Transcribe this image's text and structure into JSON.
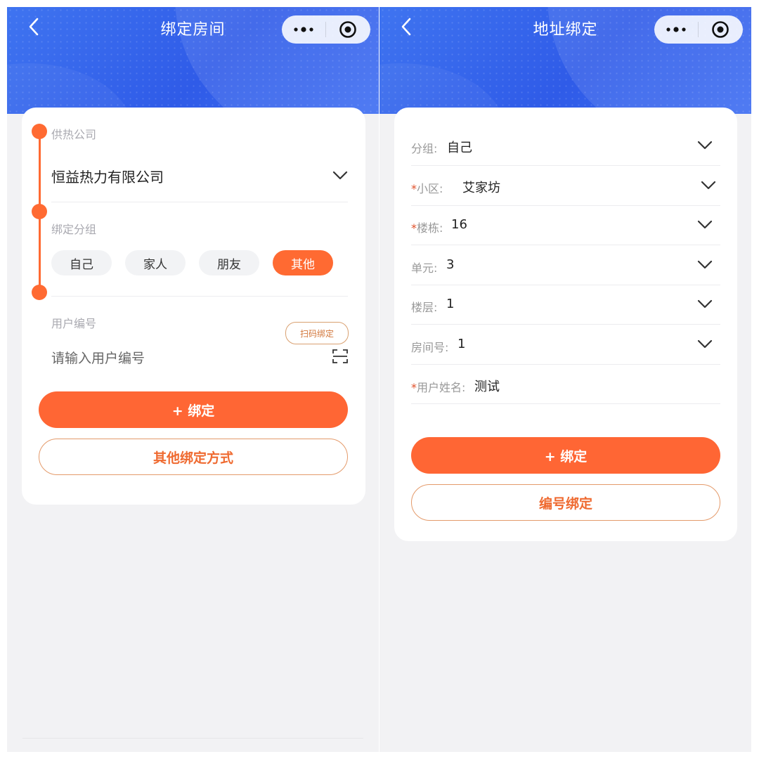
{
  "left": {
    "title": "绑定房间",
    "company": {
      "label": "供热公司",
      "value": "恒益热力有限公司"
    },
    "group": {
      "label": "绑定分组",
      "options": [
        "自己",
        "家人",
        "朋友",
        "其他"
      ],
      "selected": "其他"
    },
    "user_number": {
      "label": "用户编号",
      "placeholder": "请输入用户编号",
      "scan_label": "扫码绑定"
    },
    "bind_button": "+ 绑定",
    "other_button": "其他绑定方式"
  },
  "right": {
    "title": "地址绑定",
    "rows": [
      {
        "label": "分组:",
        "value": "自己",
        "required": false,
        "dropdown": true
      },
      {
        "label": "小区:",
        "value": "艾家坊",
        "required": true,
        "dropdown": true
      },
      {
        "label": "楼栋:",
        "value": "16",
        "required": true,
        "dropdown": true
      },
      {
        "label": "单元:",
        "value": "3",
        "required": false,
        "dropdown": true
      },
      {
        "label": "楼层:",
        "value": "1",
        "required": false,
        "dropdown": true
      },
      {
        "label": "房间号:",
        "value": "1",
        "required": false,
        "dropdown": true
      },
      {
        "label": "用户姓名:",
        "value": "测试",
        "required": true,
        "dropdown": false
      }
    ],
    "bind_button": "+ 绑定",
    "number_button": "编号绑定"
  },
  "required_mark": "*",
  "colors": {
    "accent": "#ff6634",
    "header_blue": "#3464ec",
    "background": "#f2f2f4"
  },
  "icons": [
    "back-arrow-icon",
    "more-dots-icon",
    "close-target-icon",
    "chevron-down-icon",
    "scan-icon"
  ]
}
